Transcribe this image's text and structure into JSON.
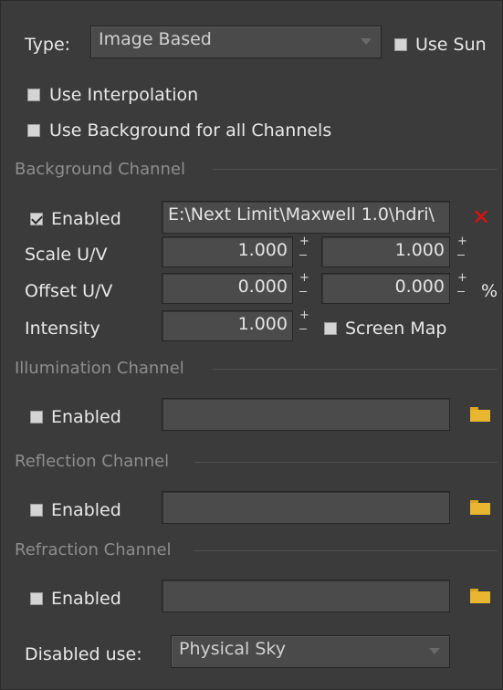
{
  "type_row": {
    "label": "Type:",
    "dropdown_value": "Image Based",
    "use_sun_label": "Use Sun",
    "use_sun_checked": false
  },
  "options": {
    "use_interpolation_label": "Use Interpolation",
    "use_background_label": "Use Background for all Channels"
  },
  "background": {
    "section_title": "Background Channel",
    "enabled_label": "Enabled",
    "enabled_checked": true,
    "path": "E:\\Next Limit\\Maxwell 1.0\\hdri\\",
    "scale_label": "Scale U/V",
    "scale_u": "1.000",
    "scale_v": "1.000",
    "offset_label": "Offset U/V",
    "offset_u": "0.000",
    "offset_v": "0.000",
    "percent": "%",
    "intensity_label": "Intensity",
    "intensity": "1.000",
    "screen_map_label": "Screen Map"
  },
  "illumination": {
    "section_title": "Illumination Channel",
    "enabled_label": "Enabled",
    "path": ""
  },
  "reflection": {
    "section_title": "Reflection Channel",
    "enabled_label": "Enabled",
    "path": ""
  },
  "refraction": {
    "section_title": "Refraction Channel",
    "enabled_label": "Enabled",
    "path": ""
  },
  "disabled_use": {
    "label": "Disabled use:",
    "dropdown_value": "Physical Sky"
  },
  "colors": {
    "panel_bg": "#3b3b3b",
    "clear_icon": "#e01010",
    "folder_icon": "#e8b630"
  },
  "icons": [
    "clear-x-icon",
    "folder-icon",
    "dropdown-arrow-icon",
    "spinner-plus-icon",
    "spinner-minus-icon"
  ]
}
